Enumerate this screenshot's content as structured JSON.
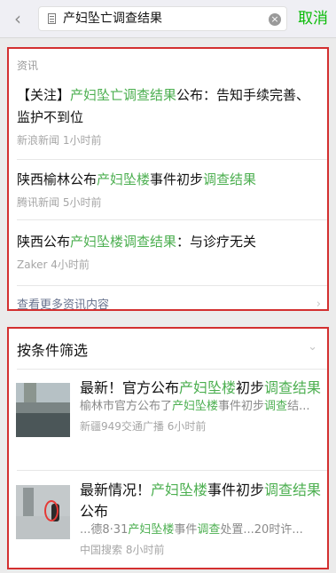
{
  "search": {
    "back_icon": "chevron-left-icon",
    "doc_icon": "document-icon",
    "query": "产妇坠亡调查结果",
    "clear_icon": "clear-icon",
    "cancel_label": "取消"
  },
  "section1": {
    "label": "资讯",
    "items": [
      {
        "title_parts": [
          {
            "text": "【关注】"
          },
          {
            "text": "产妇坠亡调查结果",
            "hl": true
          },
          {
            "text": "公布：告知手续完善、监护不到位"
          }
        ],
        "meta": "新浪新闻 1小时前"
      },
      {
        "title_parts": [
          {
            "text": "陕西榆林公布"
          },
          {
            "text": "产妇坠楼",
            "hl": true
          },
          {
            "text": "事件初步"
          },
          {
            "text": "调查结果",
            "hl": true
          }
        ],
        "meta": "腾讯新闻 5小时前"
      },
      {
        "title_parts": [
          {
            "text": "陕西公布"
          },
          {
            "text": "产妇坠楼调查结果",
            "hl": true
          },
          {
            "text": "：与诊疗无关"
          }
        ],
        "meta": "Zaker 4小时前"
      }
    ],
    "more_label": "查看更多资讯内容",
    "more_chevron_icon": "chevron-right-icon"
  },
  "section2": {
    "title": "按条件筛选",
    "chevron_icon": "chevron-down-icon",
    "items": [
      {
        "title_parts": [
          {
            "text": "最新！官方公布"
          },
          {
            "text": "产妇坠楼",
            "hl": true
          },
          {
            "text": "初步"
          },
          {
            "text": "调查结果",
            "hl": true
          }
        ],
        "snippet_parts": [
          {
            "text": "榆林市官方公布了"
          },
          {
            "text": "产妇坠楼",
            "hl": true
          },
          {
            "text": "事件初步"
          },
          {
            "text": "调查",
            "hl": true
          },
          {
            "text": "结..."
          }
        ],
        "meta": "新疆949交通广播 6小时前",
        "thumb": "building-photo"
      },
      {
        "title_parts": [
          {
            "text": "最新情况！"
          },
          {
            "text": "产妇坠楼",
            "hl": true
          },
          {
            "text": "事件初步"
          },
          {
            "text": "调查结果",
            "hl": true
          },
          {
            "text": "公布"
          }
        ],
        "snippet_parts": [
          {
            "text": "...德8·31"
          },
          {
            "text": "产妇坠楼",
            "hl": true
          },
          {
            "text": "事件"
          },
          {
            "text": "调查",
            "hl": true
          },
          {
            "text": "处置...20时许..."
          }
        ],
        "meta": "中国搜索 8小时前",
        "thumb": "hallway-photo"
      }
    ]
  },
  "colors": {
    "accent": "#4caf50",
    "cancel": "#09bb07",
    "highlight_border": "#d32f2f"
  }
}
